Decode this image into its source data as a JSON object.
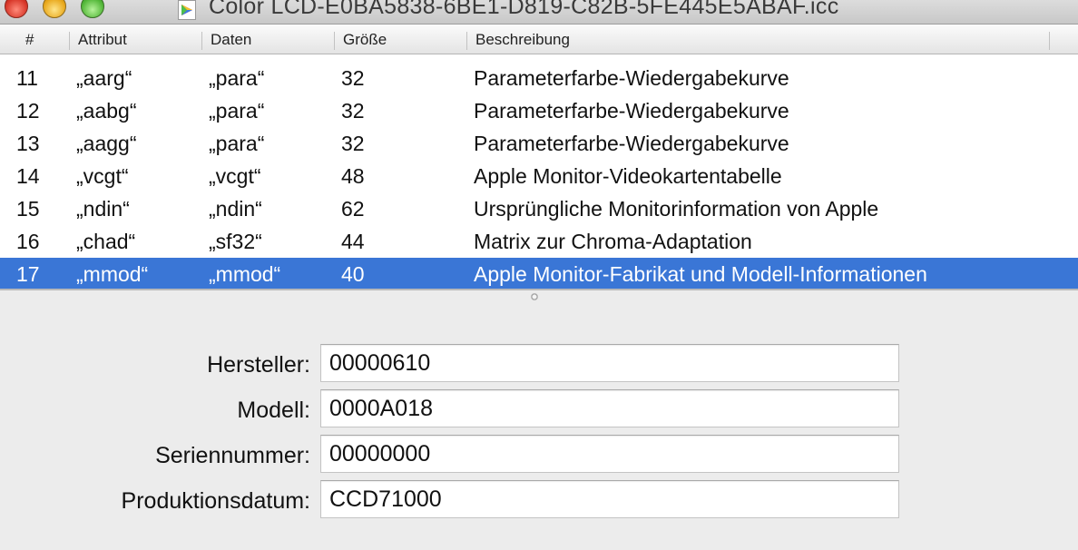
{
  "window": {
    "title": "Color LCD-E0BA5838-6BE1-D819-C82B-5FE445E5ABAF.icc",
    "proxy_icon": "colorsync-profile-icon"
  },
  "table": {
    "columns": [
      "#",
      "Attribut",
      "Daten",
      "Größe",
      "Beschreibung"
    ],
    "rows": [
      {
        "num": "11",
        "attr": "„aarg“",
        "data": "„para“",
        "size": "32",
        "desc": "Parameterfarbe-Wiedergabekurve"
      },
      {
        "num": "12",
        "attr": "„aabg“",
        "data": "„para“",
        "size": "32",
        "desc": "Parameterfarbe-Wiedergabekurve"
      },
      {
        "num": "13",
        "attr": "„aagg“",
        "data": "„para“",
        "size": "32",
        "desc": "Parameterfarbe-Wiedergabekurve"
      },
      {
        "num": "14",
        "attr": "„vcgt“",
        "data": "„vcgt“",
        "size": "48",
        "desc": "Apple Monitor-Videokartentabelle"
      },
      {
        "num": "15",
        "attr": "„ndin“",
        "data": "„ndin“",
        "size": "62",
        "desc": "Ursprüngliche Monitorinformation von Apple"
      },
      {
        "num": "16",
        "attr": "„chad“",
        "data": "„sf32“",
        "size": "44",
        "desc": "Matrix zur Chroma-Adaptation"
      },
      {
        "num": "17",
        "attr": "„mmod“",
        "data": "„mmod“",
        "size": "40",
        "desc": "Apple Monitor-Fabrikat und Modell-Informationen"
      }
    ],
    "selected_index": 6
  },
  "details": {
    "manufacturer_label": "Hersteller:",
    "manufacturer_value": "00000610",
    "model_label": "Modell:",
    "model_value": "0000A018",
    "serial_label": "Seriennummer:",
    "serial_value": "00000000",
    "date_label": "Produktionsdatum:",
    "date_value": "CCD71000"
  },
  "colors": {
    "selection": "#3a76d6"
  }
}
